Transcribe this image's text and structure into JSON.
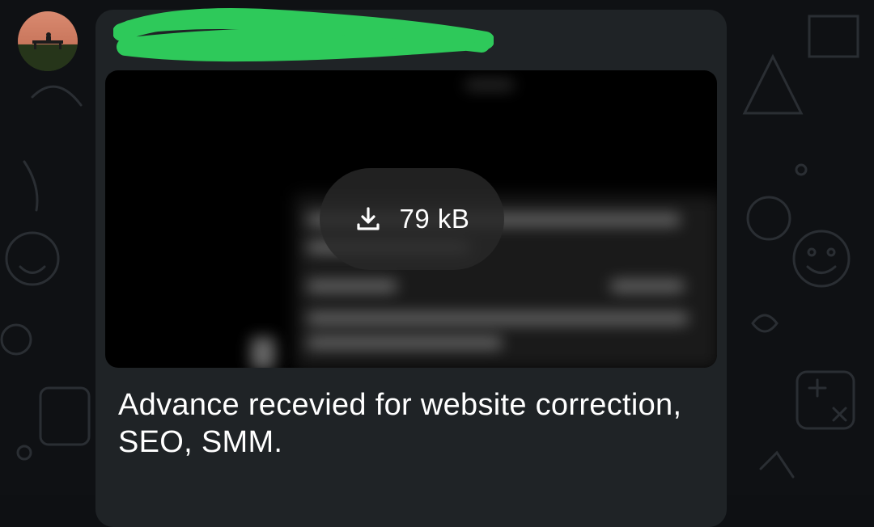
{
  "message": {
    "attachment": {
      "size_label": "79 kB",
      "icon": "download-icon"
    },
    "caption": "Advance recevied for website correction, SEO, SMM."
  },
  "colors": {
    "bubble": "#1f2326",
    "background": "#0f1114",
    "redaction_scribble": "#2ec95a",
    "text": "#ffffff"
  }
}
